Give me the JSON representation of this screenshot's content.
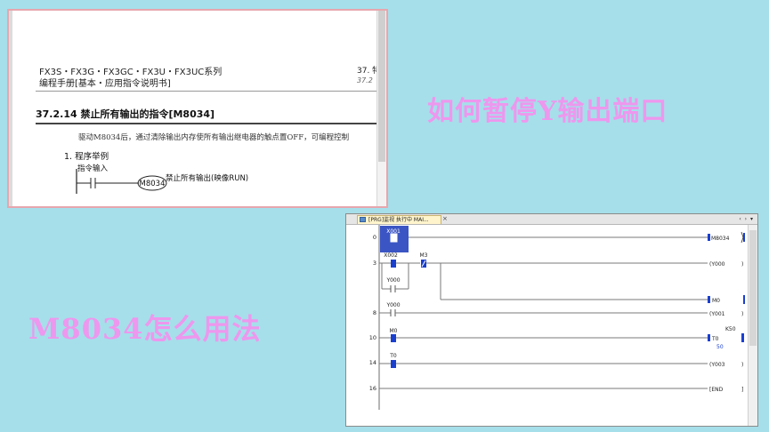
{
  "manual": {
    "series": "FX3S・FX3G・FX3GC・FX3U・FX3UC系列",
    "title": "编程手册[基本・应用指令说明书]",
    "chapter": "37. 特",
    "chapter_sub": "37.2",
    "section": "37.2.14 禁止所有输出的指令[M8034]",
    "body": "驱动M8034后，通过清除输出内存使所有输出继电器的触点置OFF，可编程控制",
    "example_heading": "1.  程序举例",
    "input_label": "指令输入",
    "coil": "M8034",
    "coil_note": "禁止所有输出(映像RUN)"
  },
  "headline_right": "如何暂停Y输出端口",
  "headline_left": "M8034怎么用法",
  "plc": {
    "tab_label": "[PRG]监视 执行中 MAI...",
    "tab_close": "×",
    "tab_scroll": "‹ › ▾",
    "steps": [
      "0",
      "3",
      "8",
      "10",
      "14",
      "16"
    ],
    "contacts": {
      "x001": "X001",
      "x002": "X002",
      "m3": "M3",
      "y000_a": "Y000",
      "y000_b": "Y000",
      "m0": "M0",
      "t0": "T0"
    },
    "outputs": {
      "m8034": "M8034",
      "y000": "(Y000",
      "m0": "M0",
      "y001": "(Y001",
      "t0": "T0",
      "y003": "(Y003",
      "end": "END"
    },
    "timer_setting": "K50",
    "timer_current": "50",
    "colors": {
      "active": "#1a3fcf",
      "line": "#7a7a7a",
      "highlight": "#3b55c4"
    }
  }
}
